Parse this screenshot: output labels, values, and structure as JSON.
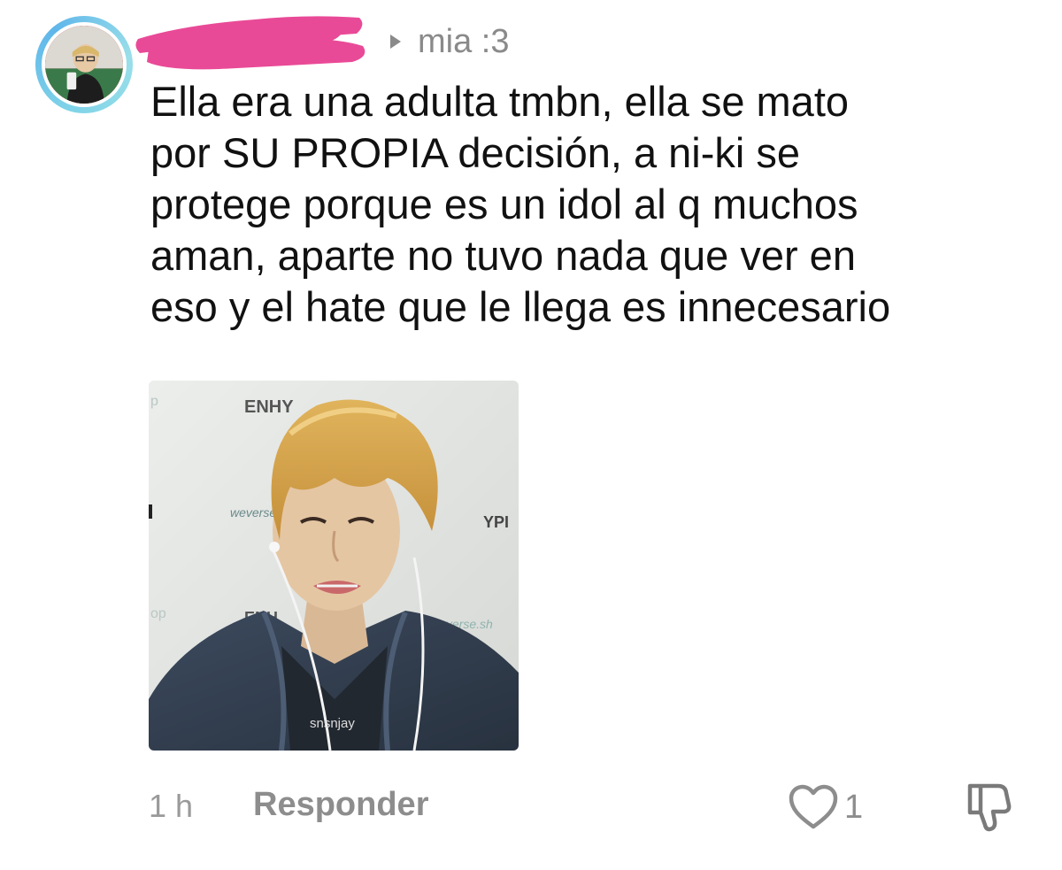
{
  "comment": {
    "reply_to": "mia :3",
    "text": "Ella era una adulta tmbn, ella se mato\npor SU PROPIA decisión, a ni-ki se\nprotege porque es un idol al q muchos\naman, aparte no tuvo nada que ver en\neso y el hate que le llega es innecesario",
    "image_text": {
      "backdrop_logo_top": "ENHY",
      "backdrop_logo_left_mid": "weverse",
      "backdrop_logo_right_mid": "YPI",
      "backdrop_logo_bottom": "ENH",
      "backdrop_logo_bottom_right": "weverse.sh",
      "backdrop_fragment_top_left": "p",
      "backdrop_fragment_bottom_left": "op",
      "watermark": "snsnjay"
    },
    "time": "1 h",
    "reply_label": "Responder",
    "like_count": "1"
  },
  "colors": {
    "avatar_ring": "#7fd3e8",
    "redaction": "#e94a97",
    "muted_text": "#8d8d8d",
    "body_text": "#111111"
  },
  "icons": {
    "reply_arrow": "caret-right-icon",
    "like": "heart-outline-icon",
    "dislike": "thumbs-down-outline-icon"
  }
}
